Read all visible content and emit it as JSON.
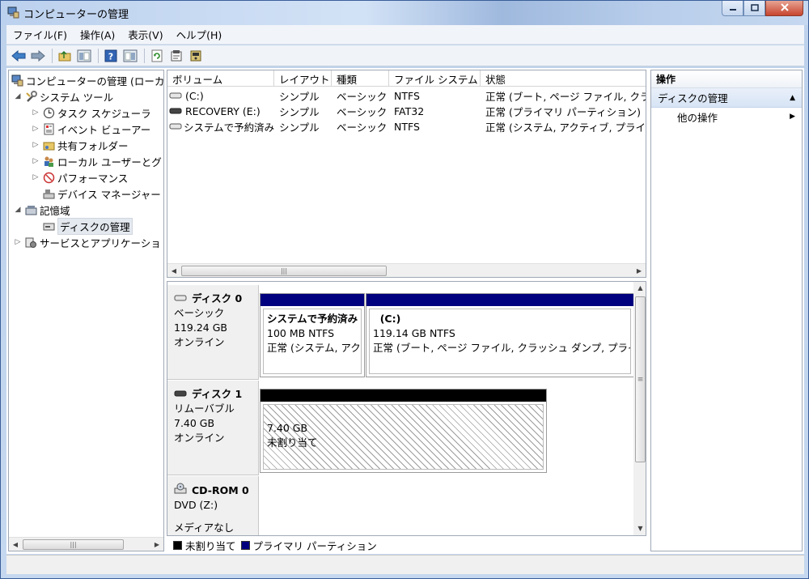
{
  "window": {
    "title": "コンピューターの管理",
    "icons": [
      "app-icon",
      "minimize-icon",
      "maximize-icon",
      "close-icon"
    ]
  },
  "menu": [
    "ファイル(F)",
    "操作(A)",
    "表示(V)",
    "ヘルプ(H)"
  ],
  "toolbar": {
    "icons": [
      "back-icon",
      "forward-icon",
      "up-folder-icon",
      "show-hide-console-tree-icon",
      "help-icon",
      "show-hide-action-pane-icon",
      "refresh-icon",
      "properties-icon",
      "disk-settings-icon"
    ]
  },
  "tree": {
    "root": "コンピューターの管理 (ローカ",
    "system_tools": "システム ツール",
    "task_scheduler": "タスク スケジューラ",
    "event_viewer": "イベント ビューアー",
    "shared_folders": "共有フォルダー",
    "local_users": "ローカル ユーザーとグ",
    "performance": "パフォーマンス",
    "device_manager": "デバイス マネージャー",
    "storage": "記憶域",
    "disk_management": "ディスクの管理",
    "services_apps": "サービスとアプリケーショ"
  },
  "volumes": {
    "headers": [
      "ボリューム",
      "レイアウト",
      "種類",
      "ファイル システム",
      "状態"
    ],
    "rows": [
      {
        "name": "(C:)",
        "layout": "シンプル",
        "type": "ベーシック",
        "fs": "NTFS",
        "status": "正常 (ブート, ページ ファイル, クラ"
      },
      {
        "name": "RECOVERY (E:)",
        "layout": "シンプル",
        "type": "ベーシック",
        "fs": "FAT32",
        "status": "正常 (プライマリ パーティション)"
      },
      {
        "name": "システムで予約済み",
        "layout": "シンプル",
        "type": "ベーシック",
        "fs": "NTFS",
        "status": "正常 (システム, アクティブ, プライマ"
      }
    ]
  },
  "disks": {
    "disk0": {
      "name": "ディスク 0",
      "type": "ベーシック",
      "size": "119.24 GB",
      "state": "オンライン",
      "parts": [
        {
          "name": "システムで予約済み",
          "size": "100 MB NTFS",
          "status": "正常 (システム, アク"
        },
        {
          "name": "(C:)",
          "size": "119.14 GB NTFS",
          "status": "正常 (ブート, ページ ファイル, クラッシュ ダンプ, プライ"
        }
      ]
    },
    "disk1": {
      "name": "ディスク 1",
      "type": "リムーバブル",
      "size": "7.40 GB",
      "state": "オンライン",
      "part": {
        "size": "7.40 GB",
        "status": "未割り当て"
      }
    },
    "cdrom0": {
      "name": "CD-ROM 0",
      "type": "DVD (Z:)",
      "media": "メディアなし"
    }
  },
  "legend": {
    "unallocated": "未割り当て",
    "primary": "プライマリ パーティション"
  },
  "actions": {
    "header": "操作",
    "section": "ディスクの管理",
    "other": "他の操作"
  },
  "colors": {
    "primary_partition": "#00007f",
    "unallocated": "#000000",
    "selection": "#d7e4f5"
  }
}
